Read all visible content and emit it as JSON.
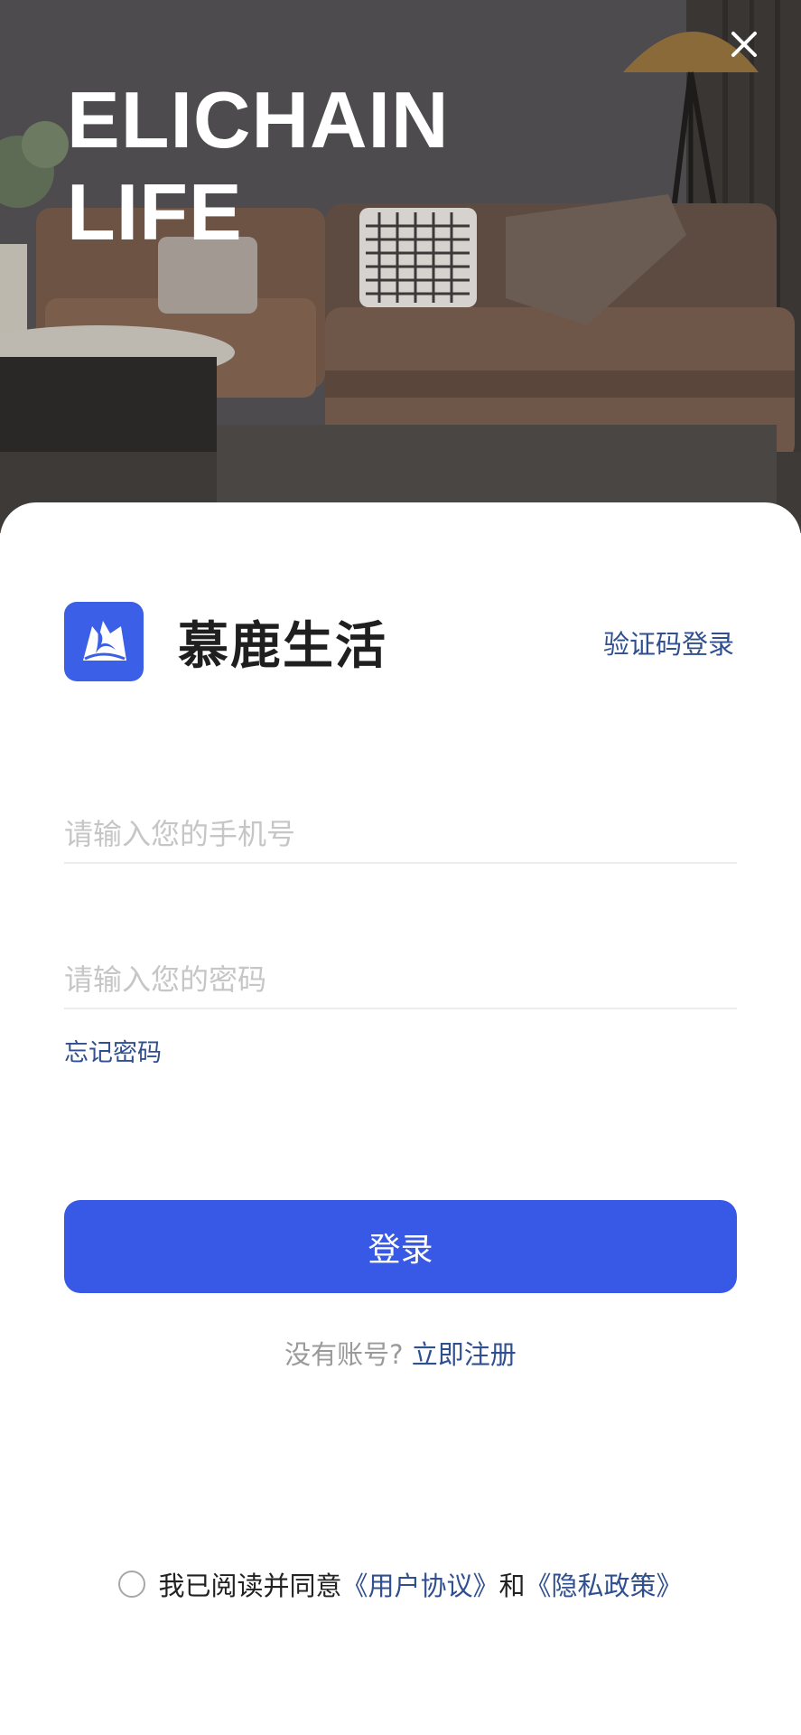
{
  "hero": {
    "title_line1": "ELICHAIN",
    "title_line2": "LIFE"
  },
  "icons": {
    "close": "close-icon",
    "logo": "deer-logo-icon",
    "radio": "radio-unchecked-icon"
  },
  "brand": {
    "name": "慕鹿生活",
    "sms_login": "验证码登录"
  },
  "form": {
    "phone_placeholder": "请输入您的手机号",
    "phone_value": "",
    "password_placeholder": "请输入您的密码",
    "password_value": "",
    "forgot_password": "忘记密码",
    "login_button": "登录"
  },
  "register": {
    "prompt": "没有账号?",
    "link": "立即注册"
  },
  "agreement": {
    "checked": false,
    "prefix": "我已阅读并同意",
    "user_agreement": "《用户协议》",
    "and": "和",
    "privacy_policy": "《隐私政策》"
  },
  "colors": {
    "accent": "#3759e6",
    "link": "#2f4f8f",
    "placeholder": "#c6c6c6"
  }
}
